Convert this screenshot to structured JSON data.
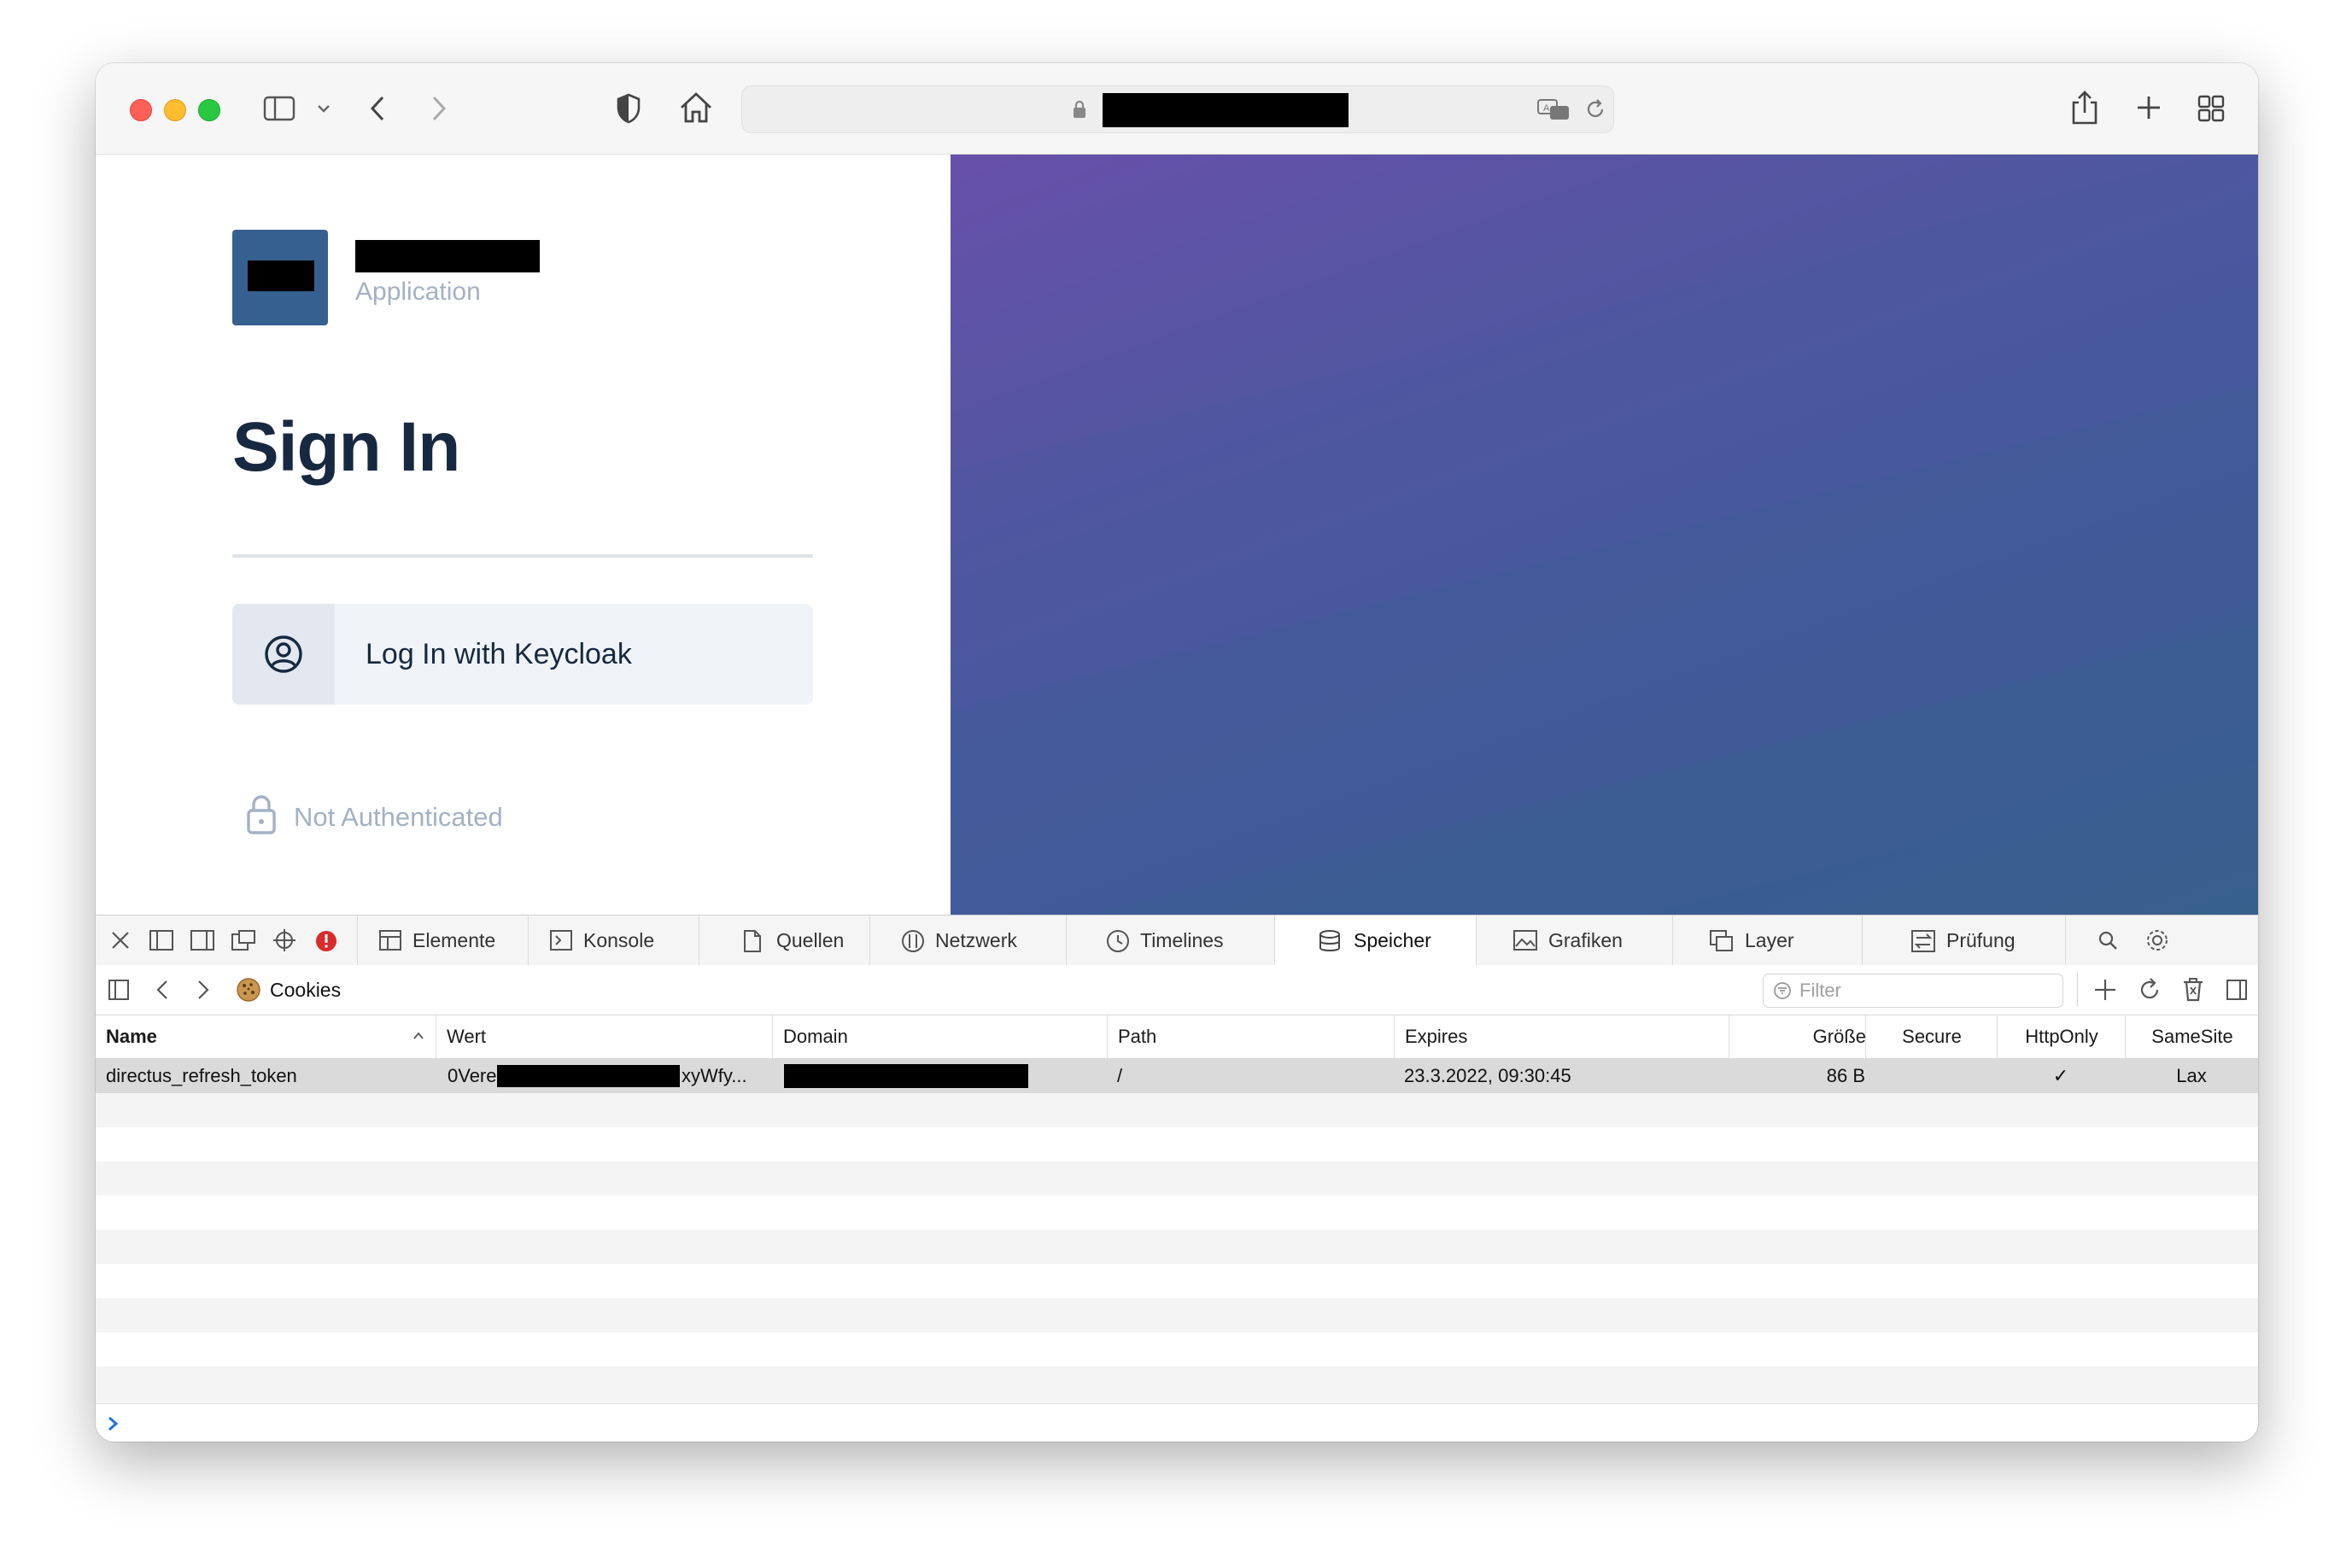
{
  "page": {
    "app_subtitle": "Application",
    "heading": "Sign In",
    "login_button_label": "Log In with Keycloak",
    "auth_status": "Not Authenticated"
  },
  "devtools": {
    "tabs": [
      {
        "label": "Elemente",
        "icon": "elements-icon"
      },
      {
        "label": "Konsole",
        "icon": "console-icon"
      },
      {
        "label": "Quellen",
        "icon": "sources-icon"
      },
      {
        "label": "Netzwerk",
        "icon": "network-icon"
      },
      {
        "label": "Timelines",
        "icon": "timelines-icon"
      },
      {
        "label": "Speicher",
        "icon": "storage-icon",
        "active": true
      },
      {
        "label": "Grafiken",
        "icon": "graphics-icon"
      },
      {
        "label": "Layer",
        "icon": "layers-icon"
      },
      {
        "label": "Prüfung",
        "icon": "audit-icon"
      }
    ],
    "storage_section": "Cookies",
    "filter_placeholder": "Filter",
    "columns": [
      "Name",
      "Wert",
      "Domain",
      "Path",
      "Expires",
      "Größe",
      "Secure",
      "HttpOnly",
      "SameSite"
    ],
    "cookies": [
      {
        "name": "directus_refresh_token",
        "value_start": "0Vere",
        "value_end": "xyWfy...",
        "path": "/",
        "expires": "23.3.2022, 09:30:45",
        "size": "86 B",
        "secure": "",
        "httponly": "✓",
        "samesite": "Lax"
      }
    ]
  },
  "colors": {
    "accent_gradient_start": "#6750aa",
    "accent_gradient_end": "#3b5f8e",
    "logo_bg": "#36608f",
    "heading_color": "#172940",
    "muted_text": "#a3b1c5",
    "error_badge": "#d92b2b",
    "console_prompt": "#1a73e8"
  }
}
